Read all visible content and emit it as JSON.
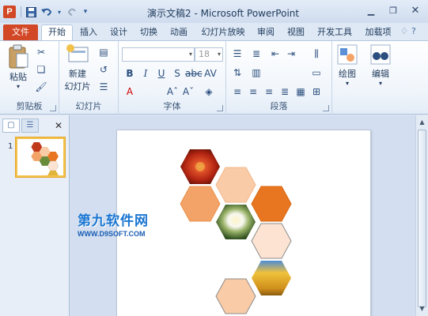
{
  "titlebar": {
    "title": "演示文稿2 - Microsoft PowerPoint",
    "app_icon": "P",
    "qat": [
      "save-icon",
      "undo-icon",
      "redo-icon"
    ],
    "window_controls": [
      "minimize-icon",
      "restore-icon",
      "close-icon"
    ]
  },
  "tabs": {
    "file": "文件",
    "items": [
      "开始",
      "插入",
      "设计",
      "切换",
      "动画",
      "幻灯片放映",
      "审阅",
      "视图",
      "开发工具",
      "加载项"
    ],
    "active": "开始"
  },
  "ribbon": {
    "clipboard": {
      "label": "剪贴板",
      "paste": "粘贴"
    },
    "slides": {
      "label": "幻灯片",
      "new_slide_line1": "新建",
      "new_slide_line2": "幻灯片"
    },
    "font": {
      "label": "字体",
      "size": "18"
    },
    "paragraph": {
      "label": "段落"
    },
    "drawing": {
      "label": "绘图"
    },
    "editing": {
      "label": "编辑"
    }
  },
  "thumbnails": {
    "slide_number": "1"
  },
  "watermark": {
    "logo": "第九软件网",
    "url": "WWW.D9SOFT.COM"
  },
  "colors": {
    "file_tab": "#d24726",
    "hex_light": "#f9cba6",
    "hex_mid": "#f3a367",
    "hex_dark": "#e8751f",
    "hex_pale": "#fde4d2"
  }
}
